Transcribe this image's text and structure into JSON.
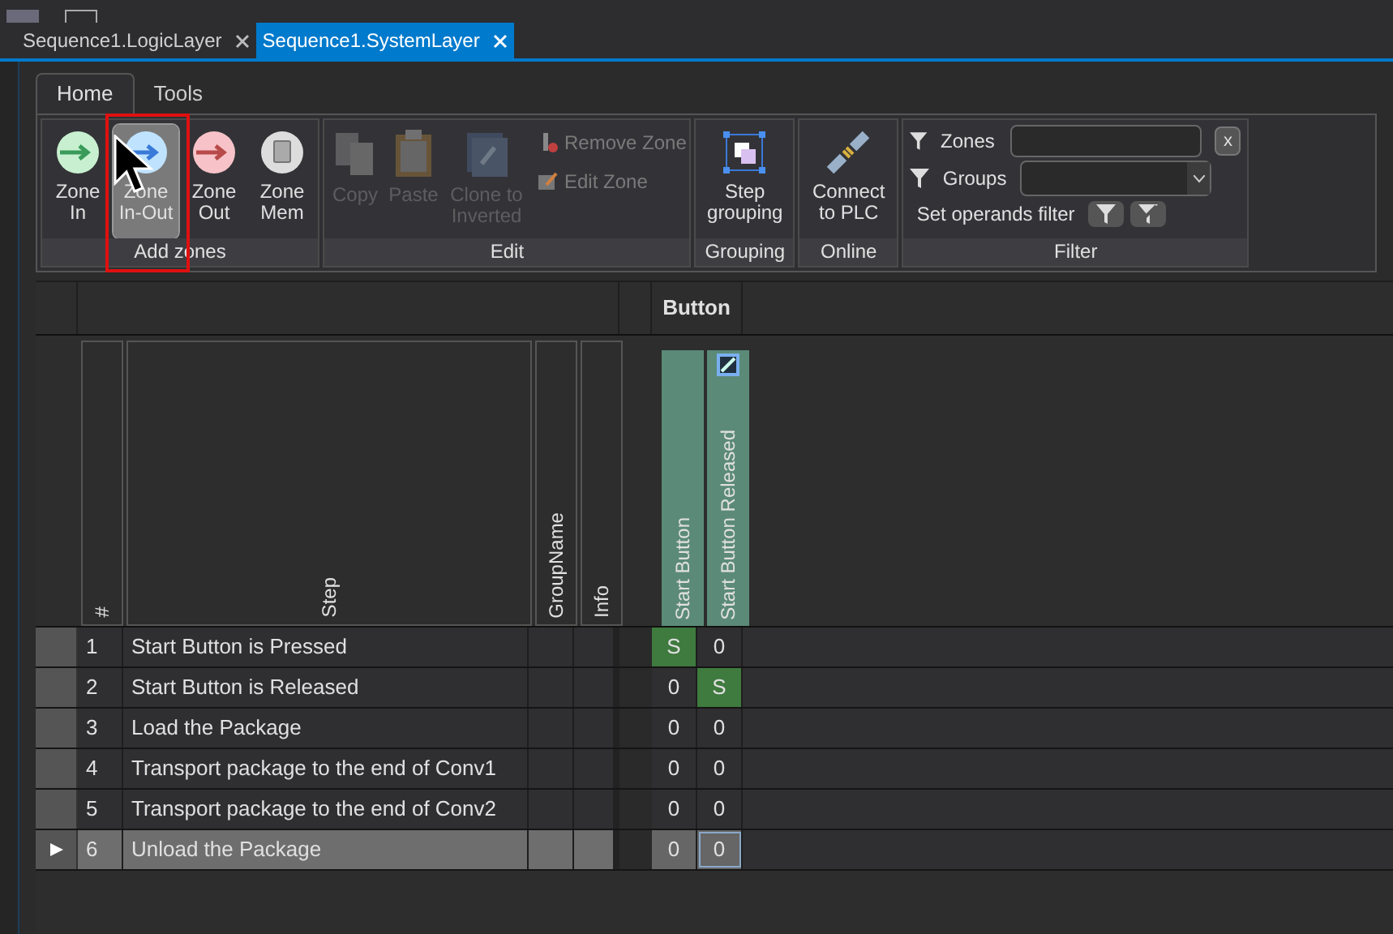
{
  "document_tabs": [
    {
      "label": "Sequence1.LogicLayer",
      "selected": false
    },
    {
      "label": "Sequence1.SystemLayer",
      "selected": true
    }
  ],
  "ribbon_tabs": [
    {
      "label": "Home",
      "selected": true
    },
    {
      "label": "Tools",
      "selected": false
    }
  ],
  "ribbon_groups": [
    {
      "label": "Add zones",
      "items": [
        {
          "label": "Zone In",
          "hovered": false,
          "disabled": false
        },
        {
          "label": "Zone In-Out",
          "hovered": true,
          "disabled": false
        },
        {
          "label": "Zone Out",
          "hovered": false,
          "disabled": false
        },
        {
          "label": "Zone Mem",
          "hovered": false,
          "disabled": false
        }
      ]
    },
    {
      "label": "Edit",
      "items": [
        {
          "label": "Copy",
          "hovered": false,
          "disabled": true
        },
        {
          "label": "Paste",
          "hovered": false,
          "disabled": true
        },
        {
          "label": "Clone to Inverted",
          "hovered": false,
          "disabled": true
        }
      ],
      "small_items": [
        {
          "label": "Remove Zone",
          "disabled": true
        },
        {
          "label": "Edit Zone",
          "disabled": true
        }
      ]
    },
    {
      "label": "Grouping",
      "items": [
        {
          "label": "Step grouping",
          "hovered": false,
          "disabled": false
        }
      ]
    },
    {
      "label": "Online",
      "items": [
        {
          "label": "Connect to PLC",
          "hovered": false,
          "disabled": false
        }
      ]
    }
  ],
  "filter": {
    "label": "Filter",
    "zones_label": "Zones",
    "groups_label": "Groups",
    "clear": "x",
    "operands_label": "Set operands filter"
  },
  "grid": {
    "group_header": "Button",
    "columns": [
      "#",
      "Step",
      "GroupName",
      "Info"
    ],
    "signal_columns": [
      "Start Button",
      "Start Button Released"
    ],
    "rows": [
      {
        "number": "1",
        "step": "Start Button is Pressed",
        "selected": false,
        "cells": [
          {
            "value": "S",
            "set": true
          },
          {
            "value": "0",
            "set": false
          }
        ]
      },
      {
        "number": "2",
        "step": "Start Button is Released",
        "selected": false,
        "cells": [
          {
            "value": "0",
            "set": false
          },
          {
            "value": "S",
            "set": true
          }
        ]
      },
      {
        "number": "3",
        "step": "Load the Package",
        "selected": false,
        "cells": [
          {
            "value": "0",
            "set": false
          },
          {
            "value": "0",
            "set": false
          }
        ]
      },
      {
        "number": "4",
        "step": "Transport package to the end of Conv1",
        "selected": false,
        "cells": [
          {
            "value": "0",
            "set": false
          },
          {
            "value": "0",
            "set": false
          }
        ]
      },
      {
        "number": "5",
        "step": "Transport package to the end of Conv2",
        "selected": false,
        "cells": [
          {
            "value": "0",
            "set": false
          },
          {
            "value": "0",
            "set": false
          }
        ]
      },
      {
        "number": "6",
        "step": "Unload the Package",
        "selected": true,
        "cells": [
          {
            "value": "0",
            "set": false
          },
          {
            "value": "0",
            "set": false
          }
        ]
      }
    ]
  }
}
